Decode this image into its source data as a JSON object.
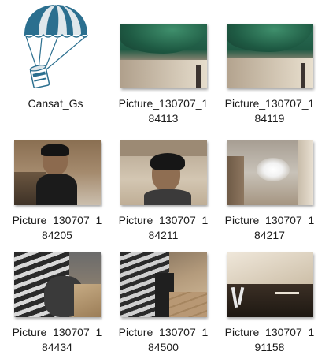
{
  "items": [
    {
      "label": "Cansat_Gs",
      "kind": "app",
      "icon": "parachute-can-icon"
    },
    {
      "label": "Picture_130707_1\n84113",
      "kind": "photo",
      "icon": "photo-thumbnail"
    },
    {
      "label": "Picture_130707_1\n84119",
      "kind": "photo",
      "icon": "photo-thumbnail"
    },
    {
      "label": "Picture_130707_1\n84205",
      "kind": "photo",
      "icon": "photo-thumbnail"
    },
    {
      "label": "Picture_130707_1\n84211",
      "kind": "photo",
      "icon": "photo-thumbnail"
    },
    {
      "label": "Picture_130707_1\n84217",
      "kind": "photo",
      "icon": "photo-thumbnail"
    },
    {
      "label": "Picture_130707_1\n84434",
      "kind": "photo",
      "icon": "photo-thumbnail"
    },
    {
      "label": "Picture_130707_1\n84500",
      "kind": "photo",
      "icon": "photo-thumbnail"
    },
    {
      "label": "Picture_130707_1\n91158",
      "kind": "photo",
      "icon": "photo-thumbnail"
    }
  ],
  "colors": {
    "parachute_blue": "#2b6f8f",
    "caption_text": "#1b1b1b"
  }
}
